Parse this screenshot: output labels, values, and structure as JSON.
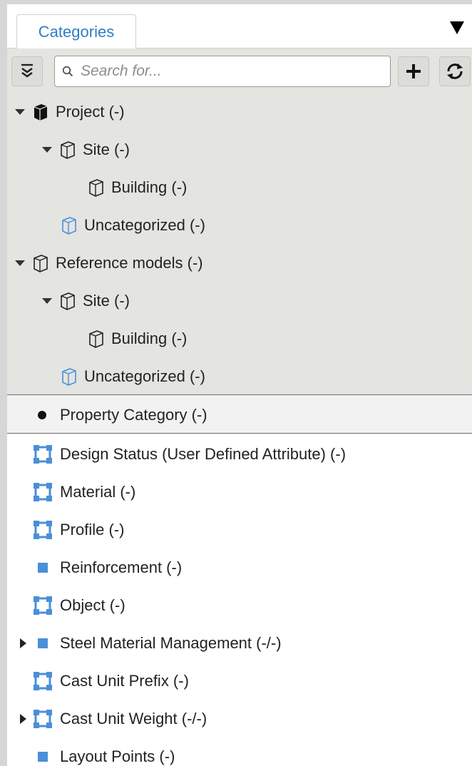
{
  "tabs": {
    "active_label": "Categories"
  },
  "toolbar": {
    "search_placeholder": "Search for..."
  },
  "icons": {
    "tab_menu": "triangle-down-icon",
    "collapse": "collapse-all-icon",
    "search": "magnifier-icon",
    "add": "plus-icon",
    "refresh": "refresh-icon"
  },
  "colors": {
    "accent_blue": "#2f7ec7",
    "icon_blue": "#4a8fd9",
    "panel_grey": "#e4e4e0"
  },
  "model_tree": [
    {
      "label": "Project (-)",
      "level": 0,
      "expanded": true,
      "icon": "box-solid-icon"
    },
    {
      "label": "Site (-)",
      "level": 1,
      "expanded": true,
      "icon": "box-outline-icon"
    },
    {
      "label": "Building (-)",
      "level": 2,
      "icon": "box-outline-icon"
    },
    {
      "label": "Uncategorized (-)",
      "level": 1,
      "icon": "box-blue-icon"
    },
    {
      "label": "Reference models (-)",
      "level": 0,
      "expanded": true,
      "icon": "box-outline-icon"
    },
    {
      "label": "Site (-)",
      "level": 1,
      "expanded": true,
      "icon": "box-outline-icon"
    },
    {
      "label": "Building (-)",
      "level": 2,
      "icon": "box-outline-icon"
    },
    {
      "label": "Uncategorized (-)",
      "level": 1,
      "icon": "box-blue-icon"
    }
  ],
  "property_header": {
    "label": "Property Category (-)"
  },
  "property_items": [
    {
      "label": "Design Status (User Defined Attribute) (-)",
      "icon": "attribute-frame-icon",
      "collapsed": false
    },
    {
      "label": "Material (-)",
      "icon": "attribute-frame-icon",
      "collapsed": false
    },
    {
      "label": "Profile (-)",
      "icon": "attribute-frame-icon",
      "collapsed": false
    },
    {
      "label": "Reinforcement (-)",
      "icon": "blue-square-icon",
      "collapsed": false
    },
    {
      "label": "Object (-)",
      "icon": "attribute-frame-icon",
      "collapsed": false
    },
    {
      "label": "Steel Material Management (-/-)",
      "icon": "blue-square-icon",
      "collapsed": true
    },
    {
      "label": "Cast Unit Prefix (-)",
      "icon": "attribute-frame-icon",
      "collapsed": false
    },
    {
      "label": "Cast Unit Weight (-/-)",
      "icon": "attribute-frame-icon",
      "collapsed": true
    },
    {
      "label": "Layout Points (-)",
      "icon": "blue-square-icon",
      "collapsed": false
    }
  ]
}
